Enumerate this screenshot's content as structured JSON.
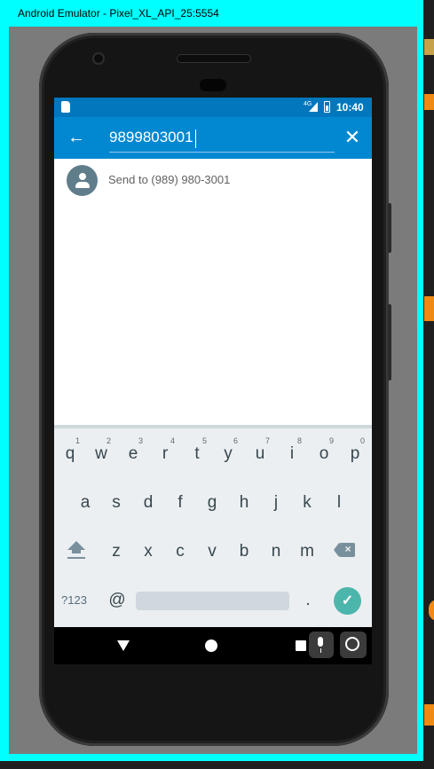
{
  "window": {
    "title": "Android Emulator - Pixel_XL_API_25:5554"
  },
  "statusbar": {
    "network_label": "4G",
    "time": "10:40"
  },
  "search": {
    "value": "9899803001"
  },
  "results": [
    {
      "label": "Send to (989) 980-3001"
    }
  ],
  "keyboard": {
    "row1": [
      {
        "key": "q",
        "hint": "1"
      },
      {
        "key": "w",
        "hint": "2"
      },
      {
        "key": "e",
        "hint": "3"
      },
      {
        "key": "r",
        "hint": "4"
      },
      {
        "key": "t",
        "hint": "5"
      },
      {
        "key": "y",
        "hint": "6"
      },
      {
        "key": "u",
        "hint": "7"
      },
      {
        "key": "i",
        "hint": "8"
      },
      {
        "key": "o",
        "hint": "9"
      },
      {
        "key": "p",
        "hint": "0"
      }
    ],
    "row2": [
      "a",
      "s",
      "d",
      "f",
      "g",
      "h",
      "j",
      "k",
      "l"
    ],
    "row3": [
      "z",
      "x",
      "c",
      "v",
      "b",
      "n",
      "m"
    ],
    "symbols_label": "?123",
    "at_label": "@",
    "period_label": "."
  },
  "colors": {
    "emulator_frame": "#00ffff",
    "status_bar": "#0277bd",
    "app_bar": "#0288d1",
    "avatar": "#607d8b",
    "enter_key": "#4db6ac",
    "keyboard_bg": "#eceff1"
  },
  "icons": {
    "back": "arrow-left",
    "clear": "close",
    "avatar": "person",
    "shift": "shift-arrow",
    "backspace": "backspace",
    "enter": "checkmark",
    "nav_back": "triangle",
    "nav_home": "circle",
    "nav_recents": "square",
    "voice": "microphone",
    "lens": "lens"
  }
}
